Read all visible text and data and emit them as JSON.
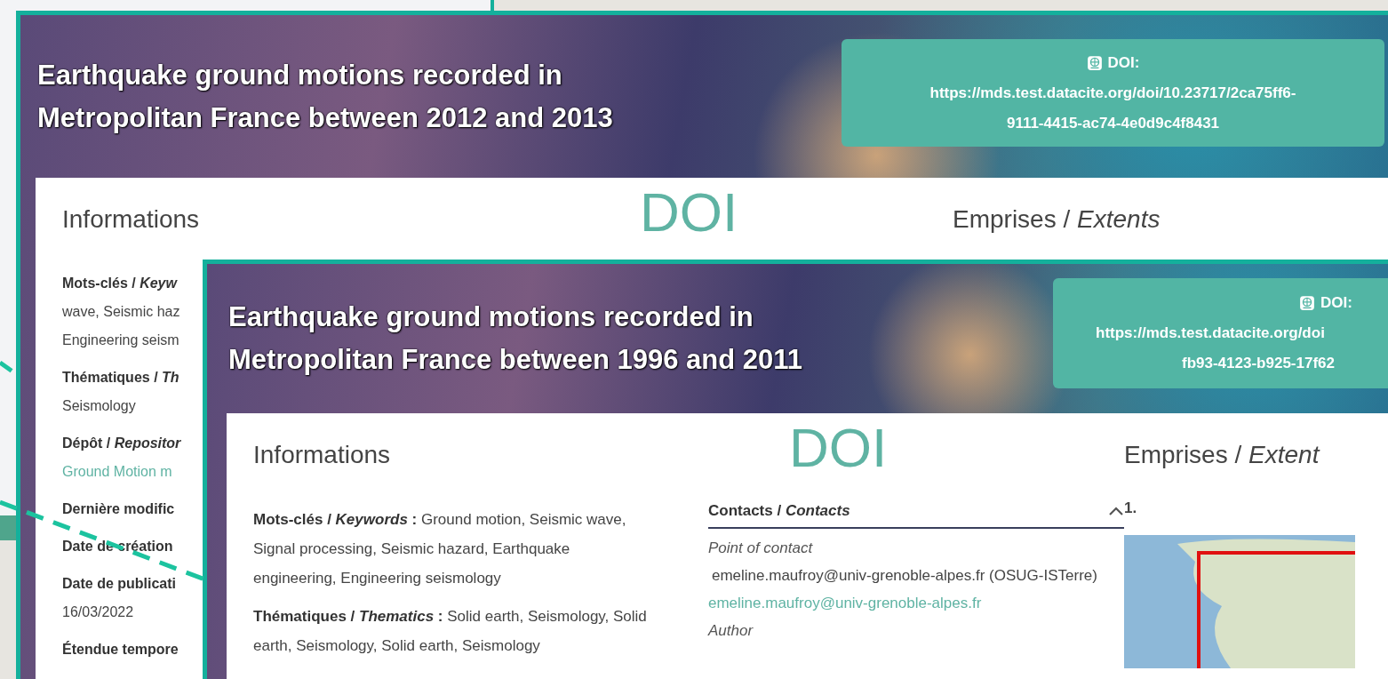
{
  "screenshots": [
    {
      "title": "Earthquake ground motions recorded in Metropolitan France between 2012 and 2013",
      "doi": {
        "label": "DOI:",
        "url_lines": [
          "https://mds.test.datacite.org/doi/10.23717/2ca75ff6-",
          "9111-4415-ac74-4e0d9c4f8431"
        ]
      },
      "doi_caption": "DOI",
      "informations": {
        "heading": "Informations",
        "fields": [
          {
            "label": "Mots-clés / *Keyw*",
            "kind": "text",
            "lines": [
              "wave, Seismic haz",
              "Engineering seism"
            ]
          },
          {
            "label": "Thématiques / *Th*",
            "kind": "text",
            "lines": [
              "Seismology"
            ]
          },
          {
            "label": "Dépôt / *Repositor*",
            "kind": "link",
            "lines": [
              "Ground Motion m"
            ]
          },
          {
            "label": "Dernière modific"
          },
          {
            "label": "Date de création"
          },
          {
            "label": "Date de publicati",
            "kind": "text",
            "lines": [
              "16/03/2022"
            ]
          },
          {
            "label": "Étendue tempore"
          }
        ]
      },
      "extents": {
        "heading": "Emprises / *Extents*"
      }
    },
    {
      "title": "Earthquake ground motions recorded in Metropolitan France between 1996 and 2011",
      "doi": {
        "label": "DOI:",
        "url_lines": [
          "https://mds.test.datacite.org/doi",
          "fb93-4123-b925-17f62"
        ]
      },
      "doi_caption": "DOI",
      "informations": {
        "heading": "Informations",
        "fields": [
          {
            "label": "Mots-clés / *Keywords* :",
            "value": "Ground motion, Seismic wave, Signal processing, Seismic hazard, Earthquake engineering, Engineering seismology"
          },
          {
            "label": "Thématiques / *Thematics* :",
            "value": "Solid earth, Seismology, Solid earth, Seismology, Solid earth, Seismology"
          }
        ]
      },
      "contacts": {
        "heading": "Contacts / *Contacts*",
        "expanded": true,
        "entries": [
          {
            "role": "Point of contact",
            "name": "emeline.maufroy@univ-grenoble-alpes.fr (OSUG-ISTerre)",
            "email": "emeline.maufroy@univ-grenoble-alpes.fr"
          },
          {
            "role": "Author"
          }
        ]
      },
      "extents": {
        "heading": "Emprises / *Extent*",
        "items": [
          {
            "number": "1."
          }
        ]
      }
    }
  ]
}
